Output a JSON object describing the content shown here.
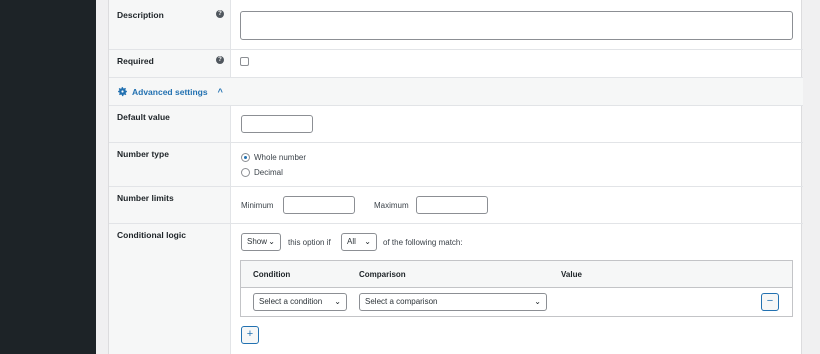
{
  "fields": {
    "description": {
      "label": "Description",
      "help": "?"
    },
    "required": {
      "label": "Required",
      "help": "?"
    },
    "advanced": {
      "label": "Advanced settings"
    },
    "default_value": {
      "label": "Default value",
      "value": ""
    },
    "number_type": {
      "label": "Number type",
      "options": [
        "Whole number",
        "Decimal"
      ],
      "selected": "Whole number"
    },
    "number_limits": {
      "label": "Number limits",
      "min_label": "Minimum",
      "max_label": "Maximum"
    },
    "conditional_logic": {
      "label": "Conditional logic",
      "action": "Show",
      "text1": "this option if",
      "match": "All",
      "text2": "of the following match:",
      "columns": [
        "Condition",
        "Comparison",
        "Value"
      ],
      "condition_placeholder": "Select a condition",
      "comparison_placeholder": "Select a comparison",
      "remove_label": "−",
      "add_label": "+"
    }
  }
}
